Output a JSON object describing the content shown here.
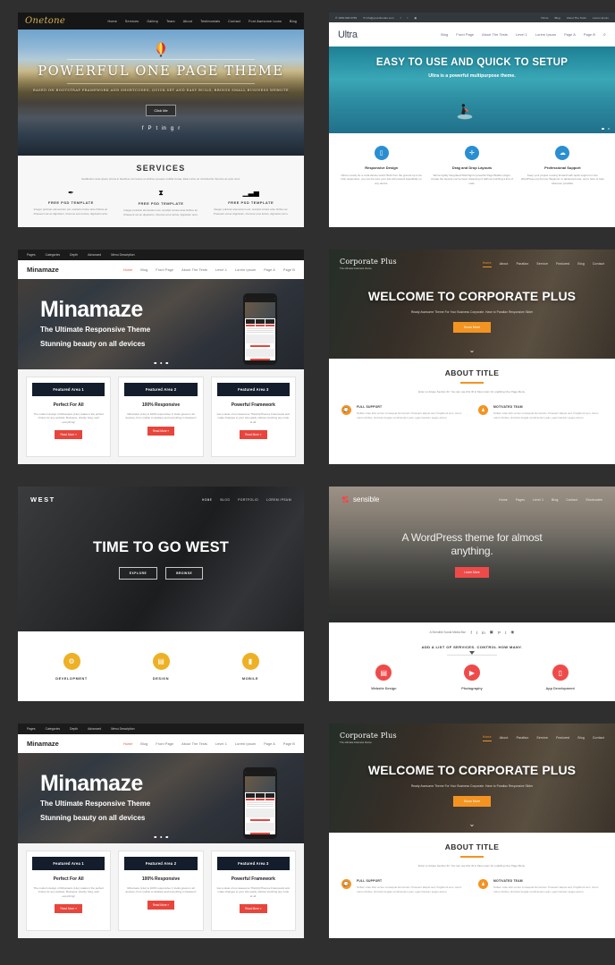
{
  "page": {
    "background": "#2f2f2f",
    "columns": 2,
    "rows": 4
  },
  "themes": [
    {
      "id": "onetone",
      "logo": "Onetone",
      "nav": [
        "Home",
        "Services",
        "Gallery",
        "Team",
        "About",
        "Testimonials",
        "Contact",
        "Font Awesome Icons",
        "Blog"
      ],
      "hero_title": "POWERFUL ONE PAGE THEME",
      "hero_sub": "BASED ON BOOTSTRAP FRAMEWORK AND SHORTCODES, QUICK SET AND EASY BUILD, BRINGS SMALL BUSINESS WEBSITE",
      "hero_button": "Click Me",
      "social": [
        "facebook",
        "pinterest",
        "twitter",
        "linkedin",
        "google-plus",
        "rss"
      ],
      "section_title": "SERVICES",
      "section_sub": "Vestibulum ante ipsum primis in faucibus orci luctus et ultrices posuere cubilia Curae; Etiam arcu ac nisl lobortis rhoncus ac quis nunc.",
      "services": [
        {
          "icon": "feather-icon",
          "title": "FREE PSD TEMPLATE",
          "text": "Integer pulvinar elementum est, suscipit ornare ante finibus ac. Praesent vel ac dignissim, rhoncus eros luctus, dignissim arcu."
        },
        {
          "icon": "hourglass-icon",
          "title": "FREE PSD TEMPLATE",
          "text": "Integer pulvinar elementum est, suscipit ornare ante finibus ac. Praesent vel ac dignissim, rhoncus eros luctus, dignissim arcu."
        },
        {
          "icon": "bar-chart-icon",
          "title": "FREE PSD TEMPLATE",
          "text": "Integer pulvinar elementum est, suscipit ornare ante finibus ac. Praesent vel ac dignissim, rhoncus eros luctus, dignissim arcu."
        }
      ]
    },
    {
      "id": "ultra",
      "logo": "Ultra",
      "topbar_phone": "1800 000 6789",
      "topbar_email": "info@yourdomain.com",
      "topbar_nav": [
        "Home",
        "Blog",
        "About The Tests",
        "Lorem Ipsum"
      ],
      "nav": [
        "Blog",
        "Front Page",
        "About The Tests",
        "Level 1",
        "Lorem Ipsum",
        "Page A",
        "Page B"
      ],
      "search_icon": "search-icon",
      "hero_title": "EASY TO USE AND QUICK TO SETUP",
      "hero_sub": "Ultra is a powerful multipurpose theme.",
      "accent": "#2a8fd0",
      "features": [
        {
          "icon": "tablet-icon",
          "title": "Responsive Design",
          "text": "Ultra is ready for a multi-device world. Built from the ground up to be fully responsive, you can be sure your site will present beautifully on any device."
        },
        {
          "icon": "move-icon",
          "title": "Drag and Drop Layouts",
          "text": "We've tightly integrated SiteOrigin's powerful Page Builder plugin. Create the layouts you've been dreaming of without touching a line of code."
        },
        {
          "icon": "support-icon",
          "title": "Professional Support",
          "text": "Keep your project moving forward with quick support on the WordPress.org forums. Beginner or advanced user, we're here to help wherever possible."
        }
      ]
    },
    {
      "id": "minamaze",
      "topbar": [
        "Pages",
        "Categories",
        "Depth",
        "Advanced",
        "Menu Description"
      ],
      "logo": "Minamaze",
      "nav": [
        "Home",
        "Blog",
        "Front Page",
        "About The Tests",
        "Level 1",
        "Lorem Ipsum",
        "Page A",
        "Page B"
      ],
      "active_nav": "Home",
      "hero_title": "Minamaze",
      "hero_line1": "The Ultimate Responsive Theme",
      "hero_line2": "Stunning beauty on all devices",
      "accent": "#e8453c",
      "cards": [
        {
          "bar": "Featured Area 1",
          "heading": "Perfect For All",
          "text": "The modern design of Minamaze (Lite) makes it the perfect choice for any website. Business, charity, blog, well everything!",
          "button": "Read More »"
        },
        {
          "bar": "Featured Area 2",
          "heading": "100% Responsive",
          "text": "Minamaze (Lite) is 100% responsive. It looks great on all devices, from mobile to desktop and everything in between!",
          "button": "Read More »"
        },
        {
          "bar": "Featured Area 3",
          "heading": "Powerful Framework",
          "text": "Get a taste of our awesome ThinkUpThemes Framework and make changes to your site easily, without touching any code at all.",
          "button": "Read More »"
        }
      ]
    },
    {
      "id": "corporate-plus",
      "logo": "Corporate Plus",
      "tagline": "The ultimate business theme",
      "nav": [
        "Home",
        "About",
        "Parallax",
        "Service",
        "Featured",
        "Blog",
        "Contact"
      ],
      "active_nav": "Home",
      "hero_title": "WELCOME TO CORPORATE PLUS",
      "hero_sub": "Ready Awesome Theme For Your Business Corporate. Have to Parallax Responsive Slider",
      "hero_button": "Know More",
      "accent": "#f39422",
      "about_title": "ABOUT TITLE",
      "about_sub": "Enter a Unique Section ID. You can use this ID in Menu item for enabling One Page Menu.",
      "about_items": [
        {
          "icon": "chat-icon",
          "title": "FULL SUPPORT",
          "text": "Nullam vitae felis vel leo consequat fermentum. Praesent aliquet sed, fringilla sit sem, lorem rutrum finibus, tincidunt feugiat condimentum quis, eget interdum augue atcum."
        },
        {
          "icon": "team-icon",
          "title": "MOTIVATED TEAM",
          "text": "Nullam vitae felis vel leo consequat fermentum. Praesent aliquet sed, fringilla sit sem, lorem rutrum finibus, tincidunt feugiat condimentum quis, eget interdum augue atcum."
        }
      ]
    },
    {
      "id": "west",
      "logo": "WEST",
      "nav": [
        "HOME",
        "BLOG",
        "PORTFOLIO",
        "LOREM IPSUM"
      ],
      "active_nav": "HOME",
      "hero_title": "TIME TO GO WEST",
      "buttons": [
        "EXPLORE",
        "BROWSE"
      ],
      "accent": "#eeb024",
      "services": [
        {
          "icon": "gear-icon",
          "title": "DEVELOPMENT"
        },
        {
          "icon": "book-icon",
          "title": "DESIGN"
        },
        {
          "icon": "mobile-icon",
          "title": "MOBILE"
        }
      ]
    },
    {
      "id": "sensible",
      "logo": "sensible",
      "logo_icon": "molecule-icon",
      "nav": [
        "Home",
        "Pages",
        "Level 1",
        "Blog",
        "Contact",
        "Shortcodes"
      ],
      "hero_line1": "A WordPress theme for almost",
      "hero_line2": "anything.",
      "hero_button": "Learn More",
      "accent": "#ef4a4a",
      "social_label": "A Sensible Social Media Bar:",
      "social_icons": [
        "facebook",
        "twitter",
        "linkedin",
        "instagram",
        "pinterest",
        "tumblr",
        "dribbble"
      ],
      "services_heading": "ADD A LIST OF SERVICES. CONTROL HOW MANY.",
      "services": [
        {
          "icon": "laptop-icon",
          "title": "Website Design"
        },
        {
          "icon": "video-icon",
          "title": "Photography"
        },
        {
          "icon": "mobile-icon",
          "title": "App Development"
        }
      ]
    }
  ],
  "layout_order": [
    "onetone",
    "ultra",
    "minamaze",
    "corporate-plus",
    "west",
    "sensible",
    "minamaze",
    "corporate-plus"
  ]
}
